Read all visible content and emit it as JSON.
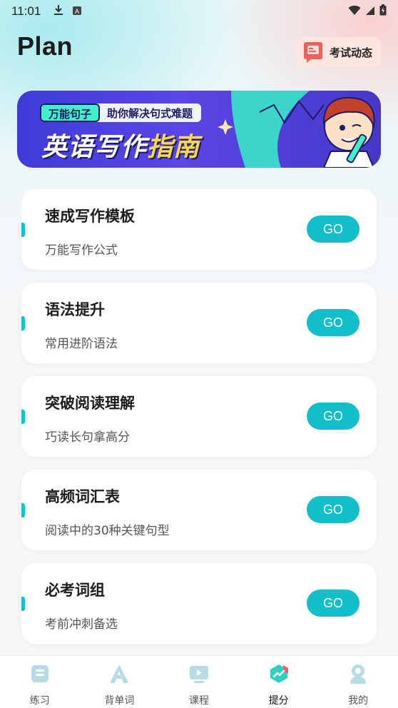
{
  "status_bar": {
    "time": "11:01"
  },
  "header": {
    "title": "Plan",
    "exam_news_label": "考试动态"
  },
  "banner": {
    "tag_key": "万能句子",
    "tag_sub": "助你解决句式难题",
    "title_main": "英语写作",
    "title_highlight": "指南"
  },
  "cards": [
    {
      "title": "速成写作模板",
      "subtitle": "万能写作公式",
      "button": "GO"
    },
    {
      "title": "语法提升",
      "subtitle": "常用进阶语法",
      "button": "GO"
    },
    {
      "title": "突破阅读理解",
      "subtitle": "巧读长句拿高分",
      "button": "GO"
    },
    {
      "title": "高频词汇表",
      "subtitle": "阅读中的30种关键句型",
      "button": "GO"
    },
    {
      "title": "必考词组",
      "subtitle": "考前冲刺备选",
      "button": "GO"
    }
  ],
  "bottom_nav": {
    "active_index": 3,
    "items": [
      {
        "label": "练习",
        "icon": "practice-icon"
      },
      {
        "label": "背单词",
        "icon": "vocabulary-icon"
      },
      {
        "label": "课程",
        "icon": "course-video-icon"
      },
      {
        "label": "提分",
        "icon": "score-up-icon"
      },
      {
        "label": "我的",
        "icon": "profile-icon"
      }
    ]
  },
  "colors": {
    "accent": "#12bfc9",
    "banner_bg": "#4a3fd9",
    "banner_highlight": "#ffd84a",
    "exam_news_bg": "#ffe6e1"
  }
}
